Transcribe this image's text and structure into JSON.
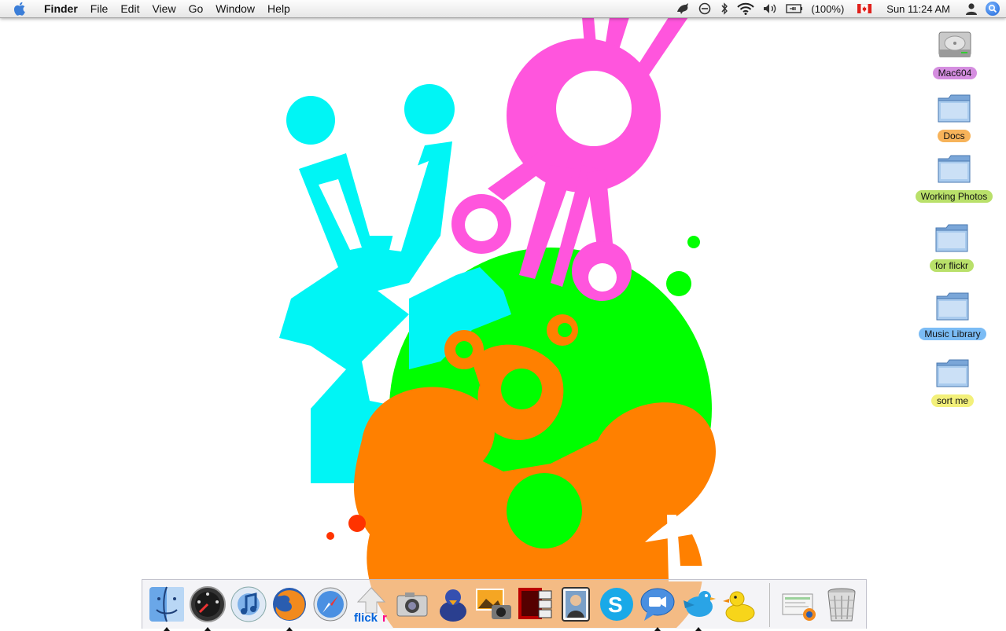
{
  "menubar": {
    "app_name": "Finder",
    "menus": [
      "File",
      "Edit",
      "View",
      "Go",
      "Window",
      "Help"
    ],
    "battery": "(100%)",
    "clock": "Sun 11:24 AM",
    "status_icons": [
      "growl-icon",
      "chat-status-icon",
      "bluetooth-icon",
      "wifi-icon",
      "volume-icon",
      "battery-icon",
      "canada-flag-icon",
      "user-icon",
      "spotlight-icon"
    ]
  },
  "desktop": {
    "icons": [
      {
        "label": "Mac604",
        "type": "hard-drive",
        "color": "#d58ee0"
      },
      {
        "label": "Docs",
        "type": "folder",
        "color": "#f7b35a"
      },
      {
        "label": "Working Photos",
        "type": "folder",
        "color": "#b9e06a"
      },
      {
        "label": "for flickr",
        "type": "folder",
        "color": "#b9e06a"
      },
      {
        "label": "Music Library",
        "type": "folder",
        "color": "#7bbcf5"
      },
      {
        "label": "sort me",
        "type": "folder",
        "color": "#f3f07a"
      }
    ]
  },
  "dock": {
    "apps": [
      {
        "name": "finder-icon",
        "running": true
      },
      {
        "name": "dashboard-icon",
        "running": true
      },
      {
        "name": "itunes-icon",
        "running": false
      },
      {
        "name": "firefox-icon",
        "running": true
      },
      {
        "name": "safari-icon",
        "running": false
      },
      {
        "name": "flickr-uploadr-icon",
        "running": false
      },
      {
        "name": "screenshot-camera-icon",
        "running": false
      },
      {
        "name": "adium-duck-icon",
        "running": false
      },
      {
        "name": "iphoto-icon",
        "running": false
      },
      {
        "name": "photo-booth-icon",
        "running": false
      },
      {
        "name": "photo-viewer-icon",
        "running": false
      },
      {
        "name": "skype-icon",
        "running": false
      },
      {
        "name": "ichat-icon",
        "running": true
      },
      {
        "name": "twitter-bird-icon",
        "running": true
      },
      {
        "name": "cyberduck-icon",
        "running": false
      }
    ],
    "others": [
      "downloads-stack-icon",
      "trash-icon"
    ]
  },
  "colors": {
    "cyan": "#00f5f5",
    "magenta": "#ff55dd",
    "green": "#00ff00",
    "orange": "#ff8000",
    "red": "#ff3300"
  }
}
